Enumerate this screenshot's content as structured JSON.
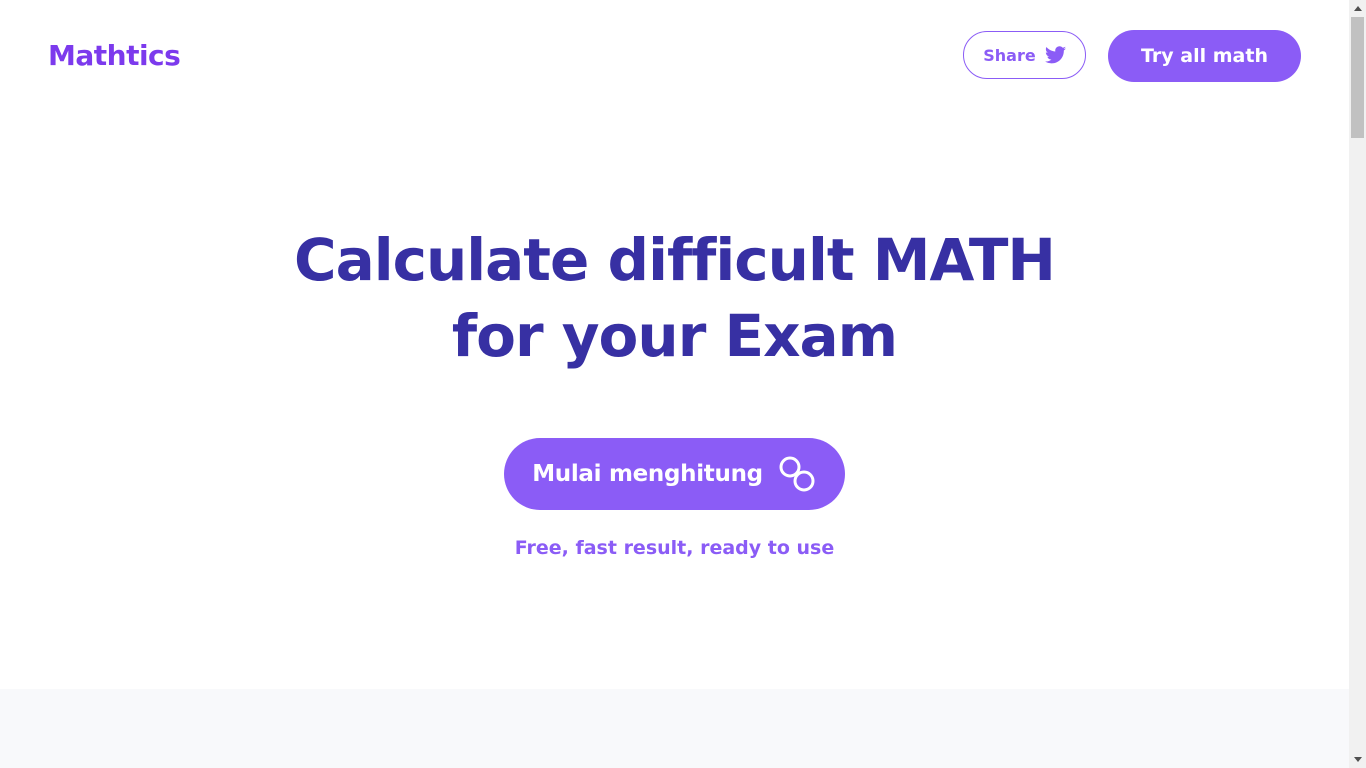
{
  "header": {
    "logo": "Mathtics",
    "share_label": "Share",
    "share_icon": "twitter-icon",
    "try_label": "Try all math"
  },
  "hero": {
    "headline_line1": "Calculate difficult MATH",
    "headline_line2": "for your Exam",
    "start_label": "Mulai menghitung",
    "start_icon": "infinity-loop-icon",
    "tagline": "Free, fast result, ready to use"
  },
  "colors": {
    "brand": "#7c3aed",
    "accent": "#8b5cf6",
    "headline": "#3730a3",
    "band": "#f8f9fb"
  }
}
